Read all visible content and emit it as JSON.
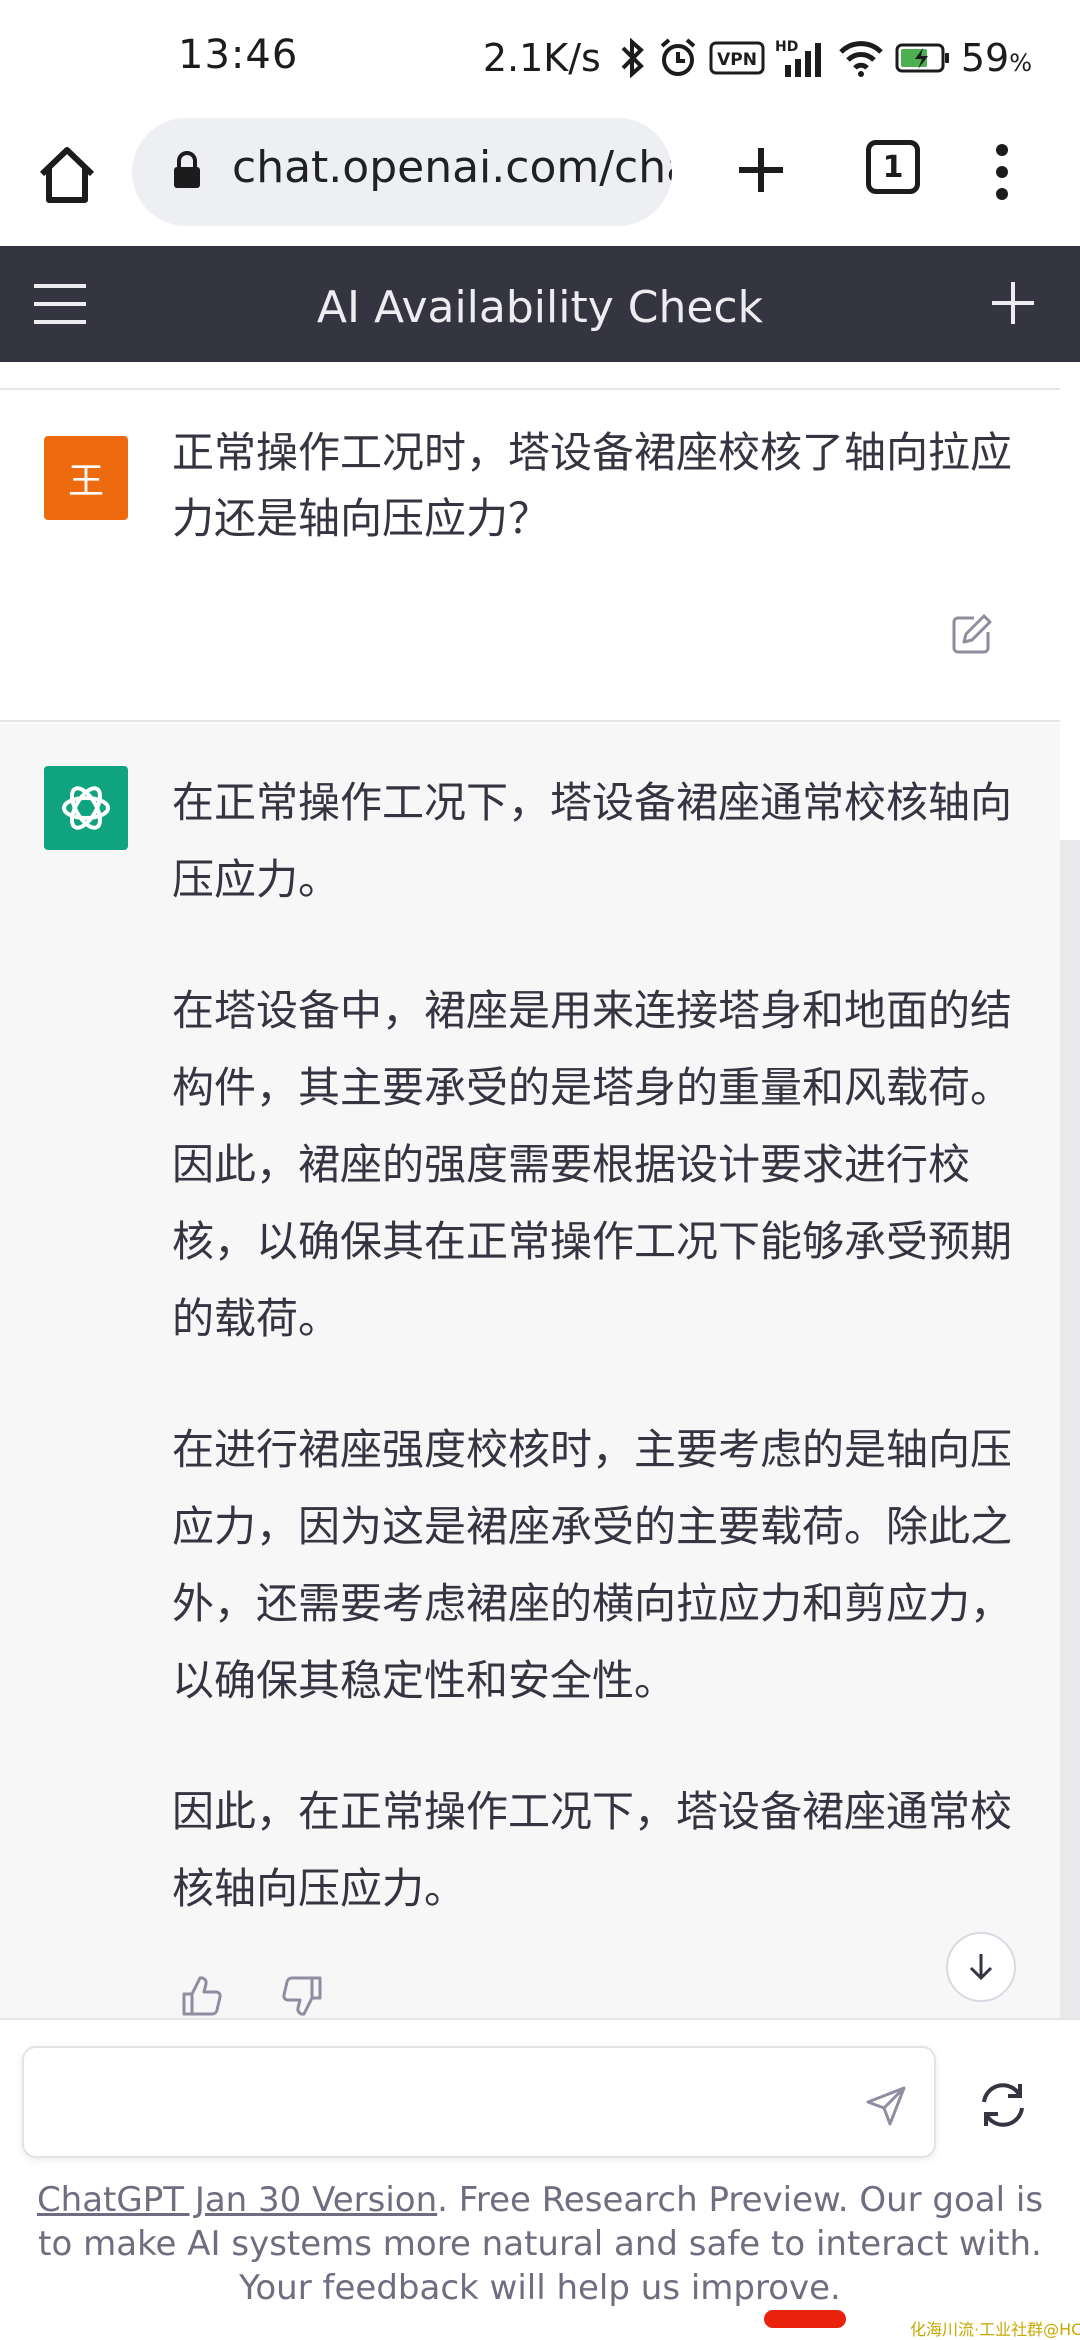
{
  "status_bar": {
    "time": "13:46",
    "net_speed": "2.1K/s",
    "vpn_label": "VPN",
    "hd_label": "HD",
    "battery_percent": "59",
    "battery_unit": "%"
  },
  "browser": {
    "url": "chat.openai.com/chat",
    "tab_count": "1"
  },
  "header": {
    "title": "AI Availability Check"
  },
  "user_message": {
    "avatar_text": "王",
    "text": "正常操作工况时，塔设备裙座校核了轴向拉应力还是轴向压应力？"
  },
  "assistant_message": {
    "paragraphs": [
      "在正常操作工况下，塔设备裙座通常校核轴向压应力。",
      "在塔设备中，裙座是用来连接塔身和地面的结构件，其主要承受的是塔身的重量和风载荷。因此，裙座的强度需要根据设计要求进行校核，以确保其在正常操作工况下能够承受预期的载荷。",
      "在进行裙座强度校核时，主要考虑的是轴向压应力，因为这是裙座承受的主要载荷。除此之外，还需要考虑裙座的横向拉应力和剪应力，以确保其稳定性和安全性。",
      "因此，在正常操作工况下，塔设备裙座通常校核轴向压应力。"
    ]
  },
  "input": {
    "value": "",
    "placeholder": ""
  },
  "footer": {
    "link_text": "ChatGPT Jan 30 Version",
    "text": ". Free Research Preview. Our goal is to make AI systems more natural and safe to interact with. Your feedback will help us improve."
  },
  "watermark": "化海川流·工业社群@HCBBS",
  "colors": {
    "header_bg": "#343541",
    "user_avatar": "#ee6a0f",
    "bot_avatar": "#10a37f",
    "assistant_bg": "#f7f7f8"
  }
}
